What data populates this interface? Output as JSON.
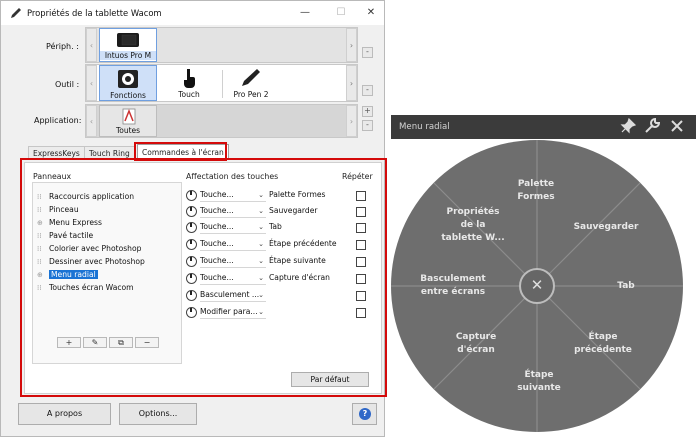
{
  "window": {
    "title": "Propriétés de la tablette Wacom",
    "controls": {
      "minimize": "—",
      "maximize": "☐",
      "close": "✕"
    }
  },
  "peripheral": {
    "label": "Périph. :",
    "devices": [
      {
        "name": "Intuos Pro M",
        "selected": true
      }
    ]
  },
  "tool": {
    "label": "Outil :",
    "tools": [
      {
        "name": "Fonctions",
        "selected": true
      },
      {
        "name": "Touch",
        "selected": false
      },
      {
        "name": "Pro Pen 2",
        "selected": false
      }
    ]
  },
  "application": {
    "label": "Application:",
    "apps": [
      {
        "name": "Toutes",
        "selected": true
      }
    ]
  },
  "tabs": [
    {
      "label": "ExpressKeys",
      "active": false
    },
    {
      "label": "Touch Ring",
      "active": false
    },
    {
      "label": "Commandes à l'écran",
      "active": true
    }
  ],
  "panels": {
    "header": "Panneaux",
    "items": [
      {
        "label": "Raccourcis application",
        "icon": "dots-icon",
        "selected": false
      },
      {
        "label": "Pinceau",
        "icon": "dots-icon",
        "selected": false
      },
      {
        "label": "Menu Express",
        "icon": "radial-icon",
        "selected": false
      },
      {
        "label": "Pavé tactile",
        "icon": "dots-icon",
        "selected": false
      },
      {
        "label": "Colorier avec Photoshop",
        "icon": "dots-icon",
        "selected": false
      },
      {
        "label": "Dessiner avec Photoshop",
        "icon": "dots-icon",
        "selected": false
      },
      {
        "label": "Menu radial",
        "icon": "radial-icon",
        "selected": true
      },
      {
        "label": "Touches écran Wacom",
        "icon": "dots-icon",
        "selected": false
      }
    ],
    "buttons": {
      "add": "+",
      "edit": "✎",
      "duplicate": "⧉",
      "remove": "−"
    }
  },
  "assignments": {
    "header": "Affectation des touches",
    "repeat_header": "Répéter",
    "rows": [
      {
        "value": "Touche...",
        "function": "Palette Formes",
        "repeat": false
      },
      {
        "value": "Touche...",
        "function": "Sauvegarder",
        "repeat": false
      },
      {
        "value": "Touche...",
        "function": "Tab",
        "repeat": false
      },
      {
        "value": "Touche...",
        "function": "Étape précédente",
        "repeat": false
      },
      {
        "value": "Touche...",
        "function": "Étape suivante",
        "repeat": false
      },
      {
        "value": "Touche...",
        "function": "Capture d'écran",
        "repeat": false
      },
      {
        "value": "Basculement ...",
        "function": "",
        "repeat": false
      },
      {
        "value": "Modifier para...",
        "function": "",
        "repeat": false
      }
    ],
    "default_button": "Par défaut"
  },
  "footer": {
    "about": "A propos",
    "options": "Options...",
    "help": "?"
  },
  "radial_menu": {
    "title": "Menu radial",
    "toolbar_icons": [
      "pin-icon",
      "wrench-icon",
      "close-icon"
    ],
    "close_glyph": "✕",
    "segments": [
      {
        "label_lines": [
          "Palette",
          "Formes"
        ]
      },
      {
        "label_lines": [
          "Sauvegarder"
        ]
      },
      {
        "label_lines": [
          "Tab"
        ]
      },
      {
        "label_lines": [
          "Étape",
          "précédente"
        ]
      },
      {
        "label_lines": [
          "Étape",
          "suivante"
        ]
      },
      {
        "label_lines": [
          "Capture",
          "d'écran"
        ]
      },
      {
        "label_lines": [
          "Basculement",
          "entre écrans"
        ]
      },
      {
        "label_lines": [
          "Propriétés",
          "de la",
          "tablette W..."
        ]
      }
    ]
  }
}
